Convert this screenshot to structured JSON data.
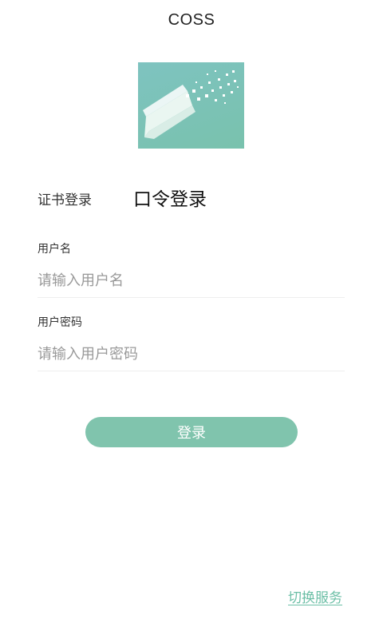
{
  "header": {
    "title": "COSS"
  },
  "logo": {
    "icon": "pencil-pixel-icon",
    "colors": {
      "top": "#7ec3c0",
      "bottom": "#79c2ad"
    }
  },
  "tabs": {
    "cert_login": "证书登录",
    "password_login": "口令登录",
    "active": "password_login"
  },
  "form": {
    "username": {
      "label": "用户名",
      "value": "",
      "placeholder": "请输入用户名"
    },
    "password": {
      "label": "用户密码",
      "value": "",
      "placeholder": "请输入用户密码"
    },
    "submit_label": "登录"
  },
  "footer": {
    "switch_service": "切换服务"
  },
  "colors": {
    "accent": "#80c4ad",
    "link": "#6cbfa6"
  }
}
